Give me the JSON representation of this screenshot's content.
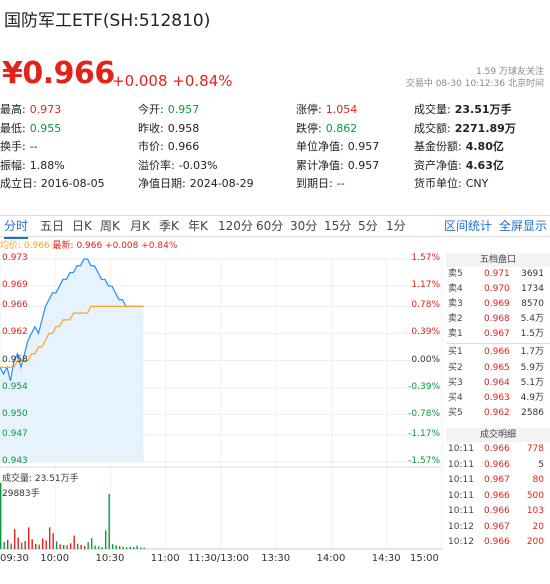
{
  "header": {
    "title": "国防军工ETF(SH:512810)",
    "price": "¥0.966",
    "change": "+0.008 +0.84%",
    "follow": "1.59 万球友关注",
    "status": "交易中 08-30 10:12:36 北京时间"
  },
  "stats": [
    [
      {
        "label": "最高:",
        "value": "0.973",
        "color": "red"
      },
      {
        "label": "今开:",
        "value": "0.957",
        "color": "green"
      },
      {
        "label": "涨停:",
        "value": "1.054",
        "color": "red"
      },
      {
        "label": "成交量:",
        "value": "23.51万手",
        "color": "bold"
      }
    ],
    [
      {
        "label": "最低:",
        "value": "0.955",
        "color": "green"
      },
      {
        "label": "昨收:",
        "value": "0.958",
        "color": ""
      },
      {
        "label": "跌停:",
        "value": "0.862",
        "color": "green"
      },
      {
        "label": "成交额:",
        "value": "2271.89万",
        "color": "bold"
      }
    ],
    [
      {
        "label": "换手:",
        "value": "--",
        "color": ""
      },
      {
        "label": "市价:",
        "value": "0.966",
        "color": ""
      },
      {
        "label": "单位净值:",
        "value": "0.957",
        "color": ""
      },
      {
        "label": "基金份额:",
        "value": "4.80亿",
        "color": "bold"
      }
    ],
    [
      {
        "label": "振幅:",
        "value": "1.88%",
        "color": ""
      },
      {
        "label": "溢价率:",
        "value": "-0.03%",
        "color": ""
      },
      {
        "label": "累计净值:",
        "value": "0.957",
        "color": ""
      },
      {
        "label": "资产净值:",
        "value": "4.63亿",
        "color": "bold"
      }
    ],
    [
      {
        "label": "成立日:",
        "value": "2016-08-05",
        "color": ""
      },
      {
        "label": "净值日期:",
        "value": "2024-08-29",
        "color": ""
      },
      {
        "label": "到期日:",
        "value": "--",
        "color": ""
      },
      {
        "label": "货币单位:",
        "value": "CNY",
        "color": ""
      }
    ]
  ],
  "tabs": [
    "分时",
    "五日",
    "日K",
    "周K",
    "月K",
    "季K",
    "年K",
    "120分",
    "60分",
    "30分",
    "15分",
    "5分",
    "1分"
  ],
  "tab_links": [
    "区间统计",
    "全屏显示"
  ],
  "legend": {
    "avg": "均价: 0.966",
    "last": "最新: 0.966 +0.008 +0.84%"
  },
  "volume": {
    "label": "成交量: 23.51万手",
    "max": "29883手"
  },
  "colors": {
    "up": "#e2231a",
    "down": "#0a9a3c",
    "price_line": "#1e90ff",
    "avg_line": "#f5a623",
    "accent": "#1d6fd3"
  },
  "chart_data": {
    "type": "line",
    "title": "",
    "y_ticks": [
      "0.973",
      "0.969",
      "0.966",
      "0.962",
      "0.958",
      "0.954",
      "0.950",
      "0.947",
      "0.943"
    ],
    "y_values": [
      0.973,
      0.969,
      0.966,
      0.962,
      0.958,
      0.954,
      0.95,
      0.947,
      0.943
    ],
    "pct_ticks": [
      "1.57%",
      "1.17%",
      "0.78%",
      "0.39%",
      "0.00%",
      "-0.39%",
      "-0.78%",
      "-1.17%",
      "-1.57%"
    ],
    "x_ticks": [
      "09:30",
      "10:00",
      "10:30",
      "11:00",
      "11:30/13:00",
      "13:30",
      "14:00",
      "14:30",
      "15:00"
    ],
    "ylim": [
      0.943,
      0.973
    ],
    "total_minutes": 240,
    "series": [
      {
        "name": "最新",
        "values": [
          0.957,
          0.956,
          0.957,
          0.955,
          0.958,
          0.959,
          0.957,
          0.959,
          0.961,
          0.962,
          0.963,
          0.962,
          0.964,
          0.966,
          0.967,
          0.968,
          0.968,
          0.969,
          0.97,
          0.97,
          0.971,
          0.971,
          0.972,
          0.972,
          0.973,
          0.973,
          0.972,
          0.972,
          0.971,
          0.97,
          0.97,
          0.969,
          0.969,
          0.968,
          0.967,
          0.967,
          0.966,
          0.966,
          0.966,
          0.966,
          0.966,
          0.966
        ]
      },
      {
        "name": "均价",
        "values": [
          0.957,
          0.957,
          0.957,
          0.957,
          0.957,
          0.958,
          0.958,
          0.958,
          0.958,
          0.959,
          0.959,
          0.96,
          0.96,
          0.961,
          0.962,
          0.962,
          0.963,
          0.963,
          0.964,
          0.964,
          0.964,
          0.965,
          0.965,
          0.965,
          0.965,
          0.965,
          0.966,
          0.966,
          0.966,
          0.966,
          0.966,
          0.966,
          0.966,
          0.966,
          0.966,
          0.966,
          0.966,
          0.966,
          0.966,
          0.966,
          0.966,
          0.966
        ]
      }
    ],
    "volume_max": 29883,
    "volumes": [
      29883,
      3200,
      4100,
      2500,
      9000,
      5200,
      2800,
      3600,
      9800,
      4400,
      2300,
      2000,
      4800,
      3900,
      9800,
      7200,
      3400,
      2100,
      1800,
      1700,
      2600,
      6100,
      2400,
      1900,
      1300,
      3100,
      4900,
      1500,
      1200,
      900,
      8400,
      25000,
      2200,
      1700,
      1300,
      1000,
      800,
      1100,
      900,
      1500,
      700,
      600
    ],
    "volume_up": [
      false,
      false,
      true,
      false,
      true,
      true,
      false,
      true,
      true,
      true,
      true,
      false,
      true,
      true,
      true,
      true,
      false,
      true,
      true,
      false,
      true,
      true,
      false,
      true,
      true,
      false,
      false,
      false,
      false,
      false,
      false,
      false,
      false,
      false,
      false,
      false,
      false,
      false,
      false,
      false,
      false,
      false
    ]
  },
  "orderbook": {
    "title": "五档盘口",
    "asks": [
      {
        "label": "卖5",
        "price": "0.971",
        "vol": "3691"
      },
      {
        "label": "卖4",
        "price": "0.970",
        "vol": "1734"
      },
      {
        "label": "卖3",
        "price": "0.969",
        "vol": "8570"
      },
      {
        "label": "卖2",
        "price": "0.968",
        "vol": "5.4万"
      },
      {
        "label": "卖1",
        "price": "0.967",
        "vol": "1.5万"
      }
    ],
    "bids": [
      {
        "label": "买1",
        "price": "0.966",
        "vol": "1.7万"
      },
      {
        "label": "买2",
        "price": "0.965",
        "vol": "5.9万"
      },
      {
        "label": "买3",
        "price": "0.964",
        "vol": "5.1万"
      },
      {
        "label": "买4",
        "price": "0.963",
        "vol": "4.9万"
      },
      {
        "label": "买5",
        "price": "0.962",
        "vol": "2586"
      }
    ]
  },
  "trades": {
    "title": "成交明细",
    "rows": [
      {
        "time": "10:11",
        "price": "0.966",
        "vol": "778",
        "dir": "up"
      },
      {
        "time": "10:11",
        "price": "0.966",
        "vol": "5",
        "dir": "none"
      },
      {
        "time": "10:11",
        "price": "0.967",
        "vol": "80",
        "dir": "up"
      },
      {
        "time": "10:11",
        "price": "0.966",
        "vol": "500",
        "dir": "up"
      },
      {
        "time": "10:11",
        "price": "0.966",
        "vol": "103",
        "dir": "up"
      },
      {
        "time": "10:12",
        "price": "0.967",
        "vol": "20",
        "dir": "up"
      },
      {
        "time": "10:12",
        "price": "0.966",
        "vol": "200",
        "dir": "up"
      }
    ]
  }
}
